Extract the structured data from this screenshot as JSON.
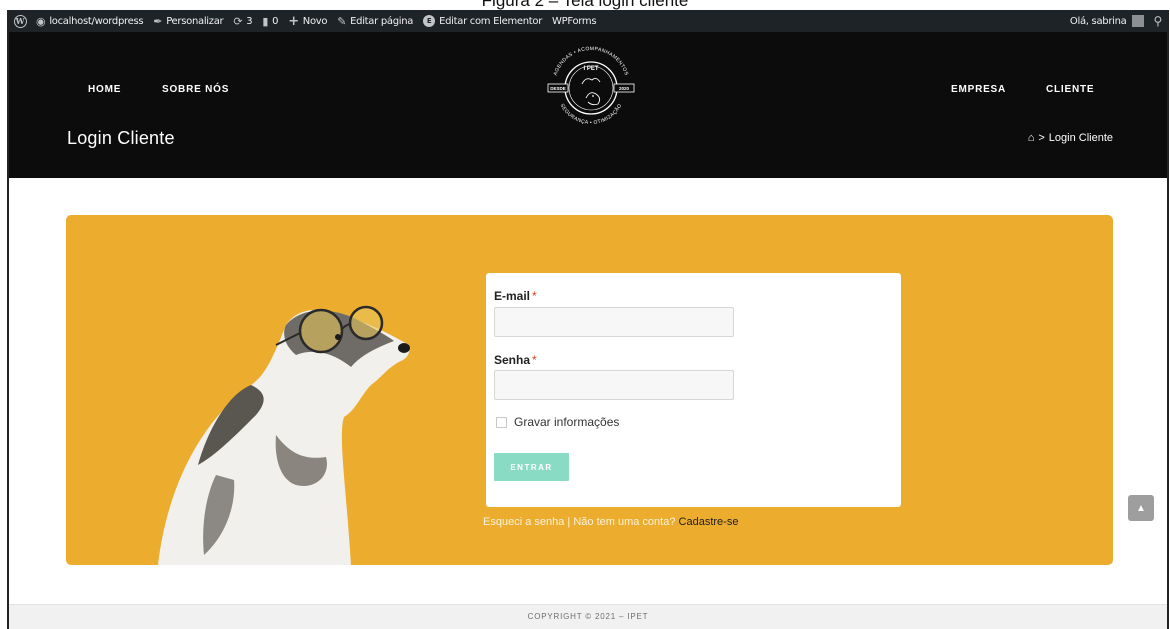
{
  "caption": "Figura 2 – Tela login cliente",
  "admin_bar": {
    "site": "localhost/wordpress",
    "customize": "Personalizar",
    "updates_count": "3",
    "comments_count": "0",
    "new": "Novo",
    "edit_page": "Editar página",
    "edit_elementor": "Editar com Elementor",
    "wpforms": "WPForms",
    "greeting": "Olá, sabrina"
  },
  "nav": {
    "home": "HOME",
    "about": "SOBRE NÓS",
    "company": "EMPRESA",
    "client": "CLIENTE"
  },
  "logo": {
    "top_text": "AGENDAS • ACOMPANHAMENTOS",
    "brand": "I PET",
    "left_tag": "DESDE",
    "right_tag": "2020",
    "bottom_text": "SEGURANÇA • OTIMIZAÇÃO"
  },
  "page_title": "Login Cliente",
  "breadcrumb": {
    "separator": ">",
    "current": "Login Cliente"
  },
  "form": {
    "email_label": "E-mail",
    "password_label": "Senha",
    "required_mark": "*",
    "email_value": "",
    "password_value": "",
    "remember_label": "Gravar informações",
    "submit": "ENTRAR"
  },
  "links": {
    "forgot": "Esqueci a senha",
    "separator": "|",
    "no_account": "Não tem uma conta?",
    "register": "Cadastre-se"
  },
  "footer": "COPYRIGHT © 2021 – IPET",
  "colors": {
    "accent": "#ecac2e",
    "header_bg": "#0c0c0c",
    "button": "#89dcc3",
    "admin_bar": "#1d2327"
  }
}
